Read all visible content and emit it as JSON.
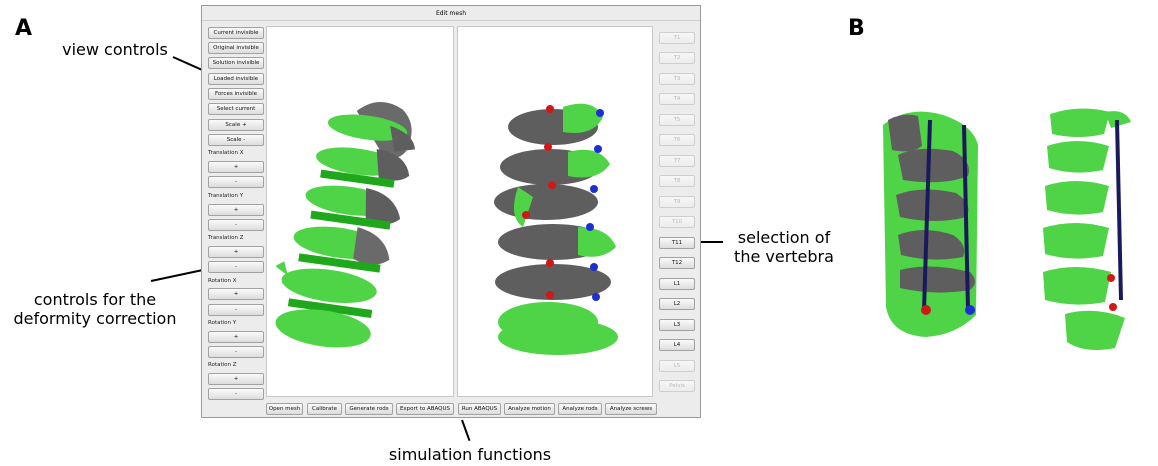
{
  "panel_labels": {
    "a": "A",
    "b": "B"
  },
  "window": {
    "title": "Edit mesh"
  },
  "left_panel": {
    "view_buttons": [
      "Current invisible",
      "Original invisible",
      "Solution invisible",
      "Loaded invisible",
      "Forces invisible",
      "Select current",
      "Scale +",
      "Scale -"
    ],
    "translation_x": {
      "label": "Translation X",
      "plus": "+",
      "minus": "-"
    },
    "translation_y": {
      "label": "Translation Y",
      "plus": "+",
      "minus": "-"
    },
    "translation_z": {
      "label": "Translation Z",
      "plus": "+",
      "minus": "-"
    },
    "rotation_x": {
      "label": "Rotation X",
      "plus": "+",
      "minus": "-"
    },
    "rotation_y": {
      "label": "Rotation Y",
      "plus": "+",
      "minus": "-"
    },
    "rotation_z": {
      "label": "Rotation Z",
      "plus": "+",
      "minus": "-"
    }
  },
  "vertebra_buttons": [
    {
      "label": "T1",
      "enabled": false
    },
    {
      "label": "T2",
      "enabled": false
    },
    {
      "label": "T3",
      "enabled": false
    },
    {
      "label": "T4",
      "enabled": false
    },
    {
      "label": "T5",
      "enabled": false
    },
    {
      "label": "T6",
      "enabled": false
    },
    {
      "label": "T7",
      "enabled": false
    },
    {
      "label": "T8",
      "enabled": false
    },
    {
      "label": "T9",
      "enabled": false
    },
    {
      "label": "T10",
      "enabled": false
    },
    {
      "label": "T11",
      "enabled": true
    },
    {
      "label": "T12",
      "enabled": true
    },
    {
      "label": "L1",
      "enabled": true
    },
    {
      "label": "L2",
      "enabled": true
    },
    {
      "label": "L3",
      "enabled": true
    },
    {
      "label": "L4",
      "enabled": true
    },
    {
      "label": "L5",
      "enabled": false
    },
    {
      "label": "Pelvis",
      "enabled": false
    }
  ],
  "bottom_buttons": [
    "Open mesh",
    "Calibrate",
    "Generate rods",
    "Export to ABAQUS",
    "Run ABAQUS",
    "Analyze motion",
    "Analyze rods",
    "Analyze screws"
  ],
  "annotations": {
    "view_controls": "view controls",
    "deformity_line1": "controls for the",
    "deformity_line2": "deformity correction",
    "selection_line1": "selection of",
    "selection_line2": "the vertebra",
    "simulation": "simulation functions"
  },
  "colors": {
    "bone_green": "#4fd447",
    "bone_grey": "#5e5e5e",
    "rod": "#1a1a5a",
    "screw_red": "#d01818",
    "screw_blue": "#1c2fd0"
  }
}
